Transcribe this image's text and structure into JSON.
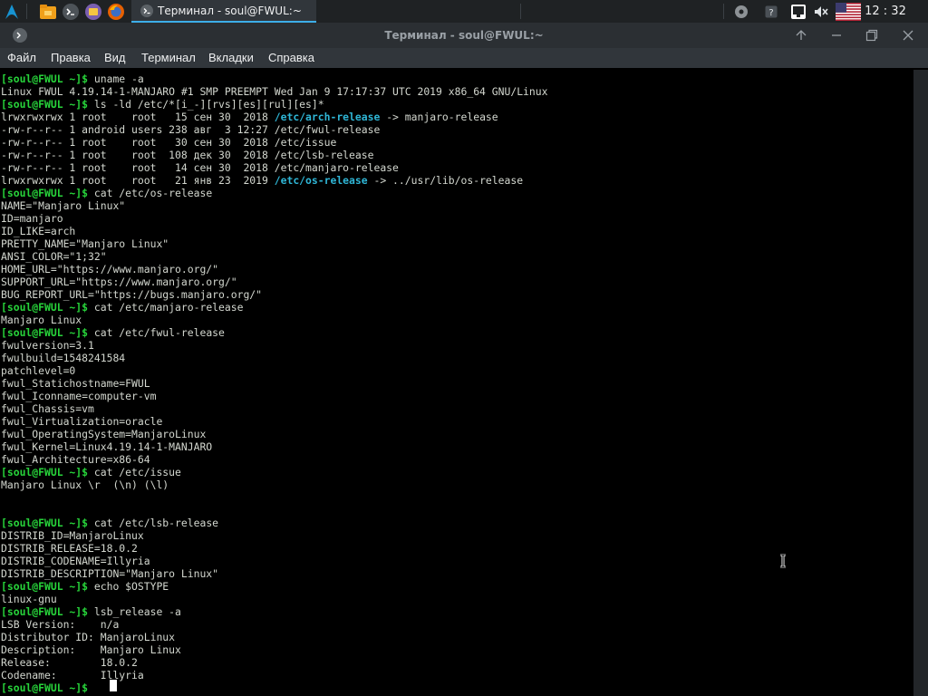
{
  "panel": {
    "task_title": "Терминал - soul@FWUL:~",
    "clock": "12 : 32"
  },
  "window": {
    "title": "Терминал - soul@FWUL:~"
  },
  "menu": [
    "Файл",
    "Правка",
    "Вид",
    "Терминал",
    "Вкладки",
    "Справка"
  ],
  "terminal": {
    "lines": [
      [
        {
          "t": "[soul@FWUL ~]$ ",
          "c": "p"
        },
        {
          "t": "uname -a"
        }
      ],
      [
        {
          "t": "Linux FWUL 4.19.14-1-MANJARO #1 SMP PREEMPT Wed Jan 9 17:17:37 UTC 2019 x86_64 GNU/Linux"
        }
      ],
      [
        {
          "t": "[soul@FWUL ~]$ ",
          "c": "p"
        },
        {
          "t": "ls -ld /etc/*[i_-][rvs][es][rul][es]*"
        }
      ],
      [
        {
          "t": "lrwxrwxrwx 1 root    root   15 сен 30  2018 "
        },
        {
          "t": "/etc/arch-release",
          "c": "b"
        },
        {
          "t": " -> manjaro-release"
        }
      ],
      [
        {
          "t": "-rw-r--r-- 1 android users 238 авг  3 12:27 /etc/fwul-release"
        }
      ],
      [
        {
          "t": "-rw-r--r-- 1 root    root   30 сен 30  2018 /etc/issue"
        }
      ],
      [
        {
          "t": "-rw-r--r-- 1 root    root  108 дек 30  2018 /etc/lsb-release"
        }
      ],
      [
        {
          "t": "-rw-r--r-- 1 root    root   14 сен 30  2018 /etc/manjaro-release"
        }
      ],
      [
        {
          "t": "lrwxrwxrwx 1 root    root   21 янв 23  2019 "
        },
        {
          "t": "/etc/os-release",
          "c": "b"
        },
        {
          "t": " -> ../usr/lib/os-release"
        }
      ],
      [
        {
          "t": "[soul@FWUL ~]$ ",
          "c": "p"
        },
        {
          "t": "cat /etc/os-release"
        }
      ],
      [
        {
          "t": "NAME=\"Manjaro Linux\""
        }
      ],
      [
        {
          "t": "ID=manjaro"
        }
      ],
      [
        {
          "t": "ID_LIKE=arch"
        }
      ],
      [
        {
          "t": "PRETTY_NAME=\"Manjaro Linux\""
        }
      ],
      [
        {
          "t": "ANSI_COLOR=\"1;32\""
        }
      ],
      [
        {
          "t": "HOME_URL=\"https://www.manjaro.org/\""
        }
      ],
      [
        {
          "t": "SUPPORT_URL=\"https://www.manjaro.org/\""
        }
      ],
      [
        {
          "t": "BUG_REPORT_URL=\"https://bugs.manjaro.org/\""
        }
      ],
      [
        {
          "t": "[soul@FWUL ~]$ ",
          "c": "p"
        },
        {
          "t": "cat /etc/manjaro-release"
        }
      ],
      [
        {
          "t": "Manjaro Linux"
        }
      ],
      [
        {
          "t": "[soul@FWUL ~]$ ",
          "c": "p"
        },
        {
          "t": "cat /etc/fwul-release"
        }
      ],
      [
        {
          "t": "fwulversion=3.1"
        }
      ],
      [
        {
          "t": "fwulbuild=1548241584"
        }
      ],
      [
        {
          "t": "patchlevel=0"
        }
      ],
      [
        {
          "t": "fwul_Statichostname=FWUL"
        }
      ],
      [
        {
          "t": "fwul_Iconname=computer-vm"
        }
      ],
      [
        {
          "t": "fwul_Chassis=vm"
        }
      ],
      [
        {
          "t": "fwul_Virtualization=oracle"
        }
      ],
      [
        {
          "t": "fwul_OperatingSystem=ManjaroLinux"
        }
      ],
      [
        {
          "t": "fwul_Kernel=Linux4.19.14-1-MANJARO"
        }
      ],
      [
        {
          "t": "fwul_Architecture=x86-64"
        }
      ],
      [
        {
          "t": "[soul@FWUL ~]$ ",
          "c": "p"
        },
        {
          "t": "cat /etc/issue"
        }
      ],
      [
        {
          "t": "Manjaro Linux \\r  (\\n) (\\l)"
        }
      ],
      [],
      [],
      [
        {
          "t": "[soul@FWUL ~]$ ",
          "c": "p"
        },
        {
          "t": "cat /etc/lsb-release"
        }
      ],
      [
        {
          "t": "DISTRIB_ID=ManjaroLinux"
        }
      ],
      [
        {
          "t": "DISTRIB_RELEASE=18.0.2"
        }
      ],
      [
        {
          "t": "DISTRIB_CODENAME=Illyria"
        }
      ],
      [
        {
          "t": "DISTRIB_DESCRIPTION=\"Manjaro Linux\""
        }
      ],
      [
        {
          "t": "[soul@FWUL ~]$ ",
          "c": "p"
        },
        {
          "t": "echo $OSTYPE"
        }
      ],
      [
        {
          "t": "linux-gnu"
        }
      ],
      [
        {
          "t": "[soul@FWUL ~]$ ",
          "c": "p"
        },
        {
          "t": "lsb_release -a"
        }
      ],
      [
        {
          "t": "LSB Version:    n/a"
        }
      ],
      [
        {
          "t": "Distributor ID: ManjaroLinux"
        }
      ],
      [
        {
          "t": "Description:    Manjaro Linux"
        }
      ],
      [
        {
          "t": "Release:        18.0.2"
        }
      ],
      [
        {
          "t": "Codename:       Illyria"
        }
      ],
      [
        {
          "t": "[soul@FWUL ~]$ ",
          "c": "p"
        }
      ]
    ]
  },
  "colors": {
    "prompt": "#27d33a",
    "symlink": "#2fb6d6",
    "accent": "#3daee9"
  }
}
